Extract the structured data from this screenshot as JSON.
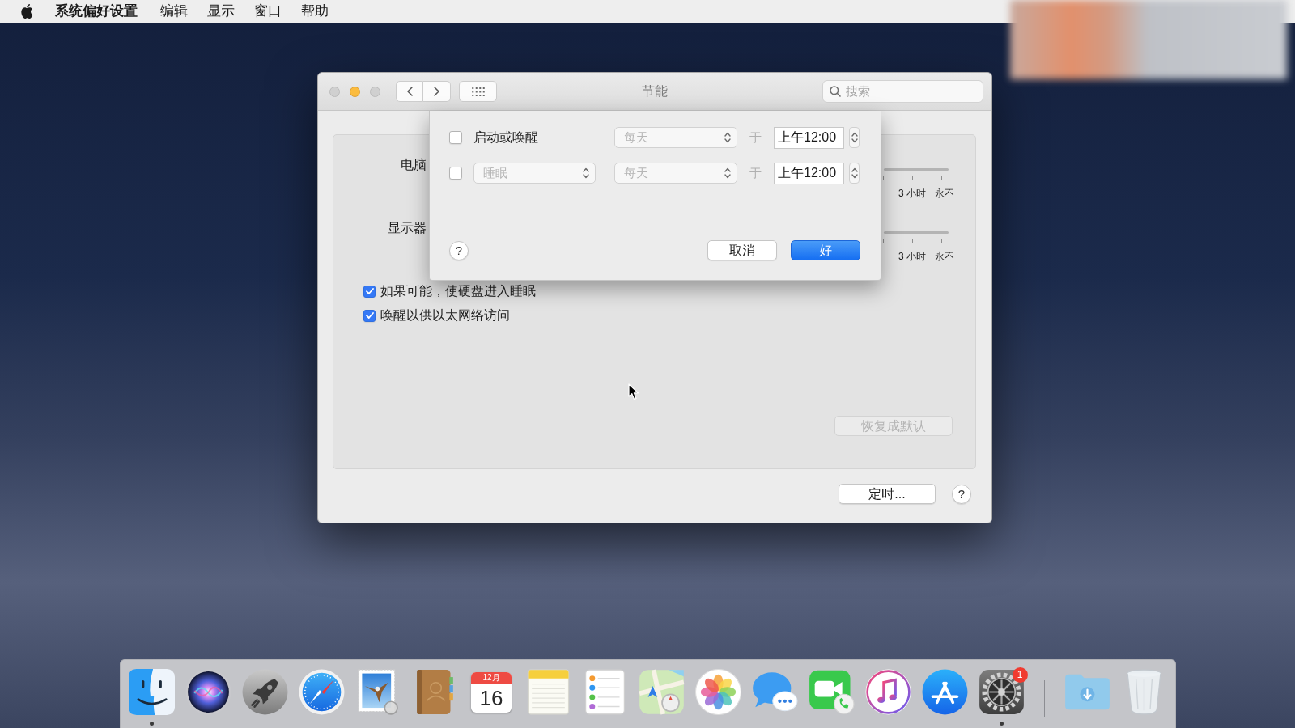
{
  "menu_bar": {
    "app_name": "系统偏好设置",
    "menus": [
      "编辑",
      "显示",
      "窗口",
      "帮助"
    ]
  },
  "window": {
    "title": "节能",
    "controls": [
      {
        "kind": "close",
        "disabled": true
      },
      {
        "kind": "minimize",
        "disabled": false
      },
      {
        "kind": "zoom",
        "disabled": true
      }
    ],
    "search": {
      "placeholder": "搜索"
    },
    "settings": {
      "rows": [
        {
          "label": "电脑",
          "scale_labels": [
            "3 小时",
            "永不"
          ]
        },
        {
          "label": "显示器",
          "scale_labels": [
            "3 小时",
            "永不"
          ]
        }
      ],
      "checkboxes": [
        {
          "label": "如果可能，使硬盘进入睡眠",
          "checked": true
        },
        {
          "label": "唤醒以供以太网络访问",
          "checked": true
        }
      ],
      "restore_button": {
        "label": "恢复成默认",
        "disabled": true
      }
    },
    "schedule_button": {
      "label": "定时..."
    },
    "help_button": {
      "label": "?"
    }
  },
  "schedule_sheet": {
    "rows": [
      {
        "checked": false,
        "event": {
          "kind": "label",
          "text": "启动或唤醒"
        },
        "repeat": {
          "value": "每天",
          "disabled": true
        },
        "at": "于",
        "time": "上午12:00"
      },
      {
        "checked": false,
        "event": {
          "kind": "select",
          "text": "睡眠",
          "disabled": true
        },
        "repeat": {
          "value": "每天",
          "disabled": true
        },
        "at": "于",
        "time": "上午12:00"
      }
    ],
    "help_button": {
      "label": "?"
    },
    "buttons": [
      {
        "label": "取消",
        "kind": "normal"
      },
      {
        "label": "好",
        "kind": "primary"
      }
    ]
  },
  "dock": {
    "items": [
      {
        "kind": "face",
        "running": true
      },
      {
        "kind": "orb",
        "running": false
      },
      {
        "kind": "rocket",
        "running": false
      },
      {
        "kind": "compass",
        "running": false
      },
      {
        "kind": "stamp",
        "running": false
      },
      {
        "kind": "book",
        "running": false
      },
      {
        "kind": "calendar",
        "running": false,
        "month": "12月",
        "day": "16"
      },
      {
        "kind": "notepad",
        "running": false
      },
      {
        "kind": "checklist",
        "running": false
      },
      {
        "kind": "map",
        "running": false
      },
      {
        "kind": "flower",
        "running": false
      },
      {
        "kind": "chat",
        "running": false
      },
      {
        "kind": "camera",
        "running": false
      },
      {
        "kind": "music",
        "running": false
      },
      {
        "kind": "tools",
        "running": false
      },
      {
        "kind": "gear",
        "running": true,
        "badge": "1"
      },
      {
        "kind": "separator"
      },
      {
        "kind": "folder",
        "running": false
      },
      {
        "kind": "trash",
        "running": false
      }
    ]
  }
}
